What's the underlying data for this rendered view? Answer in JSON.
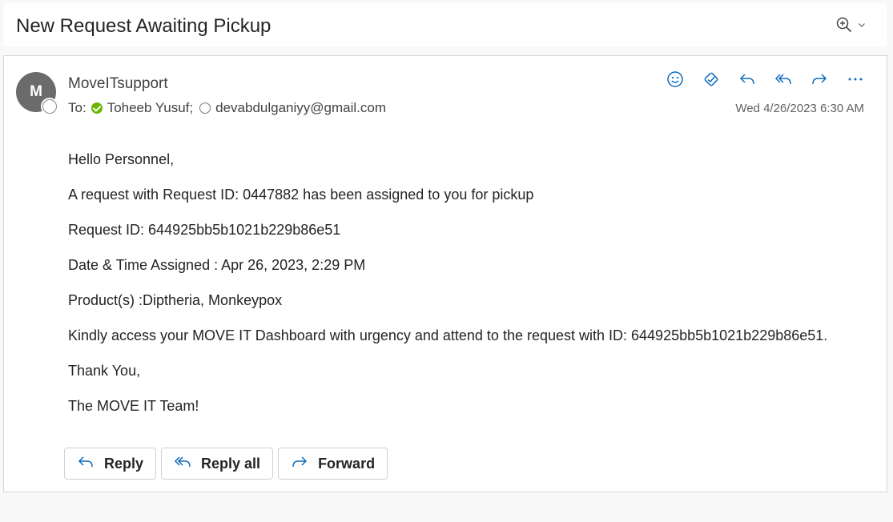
{
  "subject": "New Request Awaiting Pickup",
  "toolbar": {
    "zoom_icon": "zoom-in-icon",
    "dropdown_icon": "chevron-down-icon"
  },
  "message": {
    "avatar_initial": "M",
    "sender": "MoveITsupport",
    "to_label": "To:",
    "recipients": [
      {
        "name": "Toheeb Yusuf;",
        "status": "available"
      },
      {
        "name": "devabdulganiyy@gmail.com",
        "status": "offline"
      }
    ],
    "timestamp": "Wed 4/26/2023 6:30 AM",
    "actions": [
      "emoji-icon",
      "apps-icon",
      "reply-icon",
      "reply-all-icon",
      "forward-icon",
      "more-icon"
    ],
    "body": [
      "Hello Personnel,",
      "A request with Request ID: 0447882 has been assigned to you for pickup",
      "Request ID: 644925bb5b1021b229b86e51",
      "Date & Time Assigned : Apr 26, 2023, 2:29 PM",
      "Product(s) :Diptheria, Monkeypox",
      "Kindly access your MOVE IT Dashboard with urgency and attend to the request with ID: 644925bb5b1021b229b86e51.",
      "Thank You,",
      "The MOVE IT Team!"
    ]
  },
  "reply_bar": {
    "reply": "Reply",
    "reply_all": "Reply all",
    "forward": "Forward"
  },
  "colors": {
    "accent": "#0f6cbd",
    "available": "#6bb700",
    "avatar": "#6b6b6b"
  }
}
